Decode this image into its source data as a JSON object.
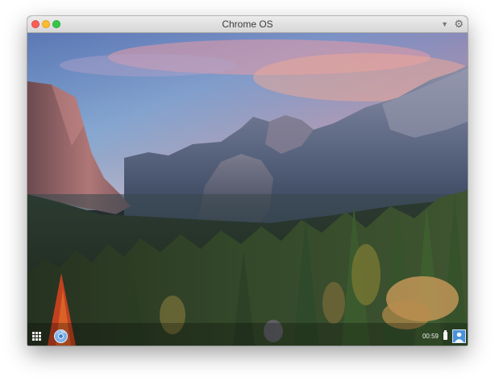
{
  "window": {
    "title": "Chrome OS",
    "dropdown_icon": "chevron-down-icon",
    "settings_icon": "gear-icon",
    "controls": [
      "close",
      "minimize",
      "maximize"
    ],
    "control_colors": {
      "close": "#fc5f57",
      "minimize": "#fdbc2e",
      "maximize": "#34c84a"
    }
  },
  "desktop": {
    "wallpaper": "mountain-valley-sunset"
  },
  "shelf": {
    "launcher_icon": "app-launcher-icon",
    "pinned_apps": [
      {
        "icon": "chrome-browser-icon"
      }
    ],
    "status_area": {
      "time": "00:59",
      "battery_icon": "battery-icon",
      "avatar_icon": "user-avatar-icon"
    }
  }
}
